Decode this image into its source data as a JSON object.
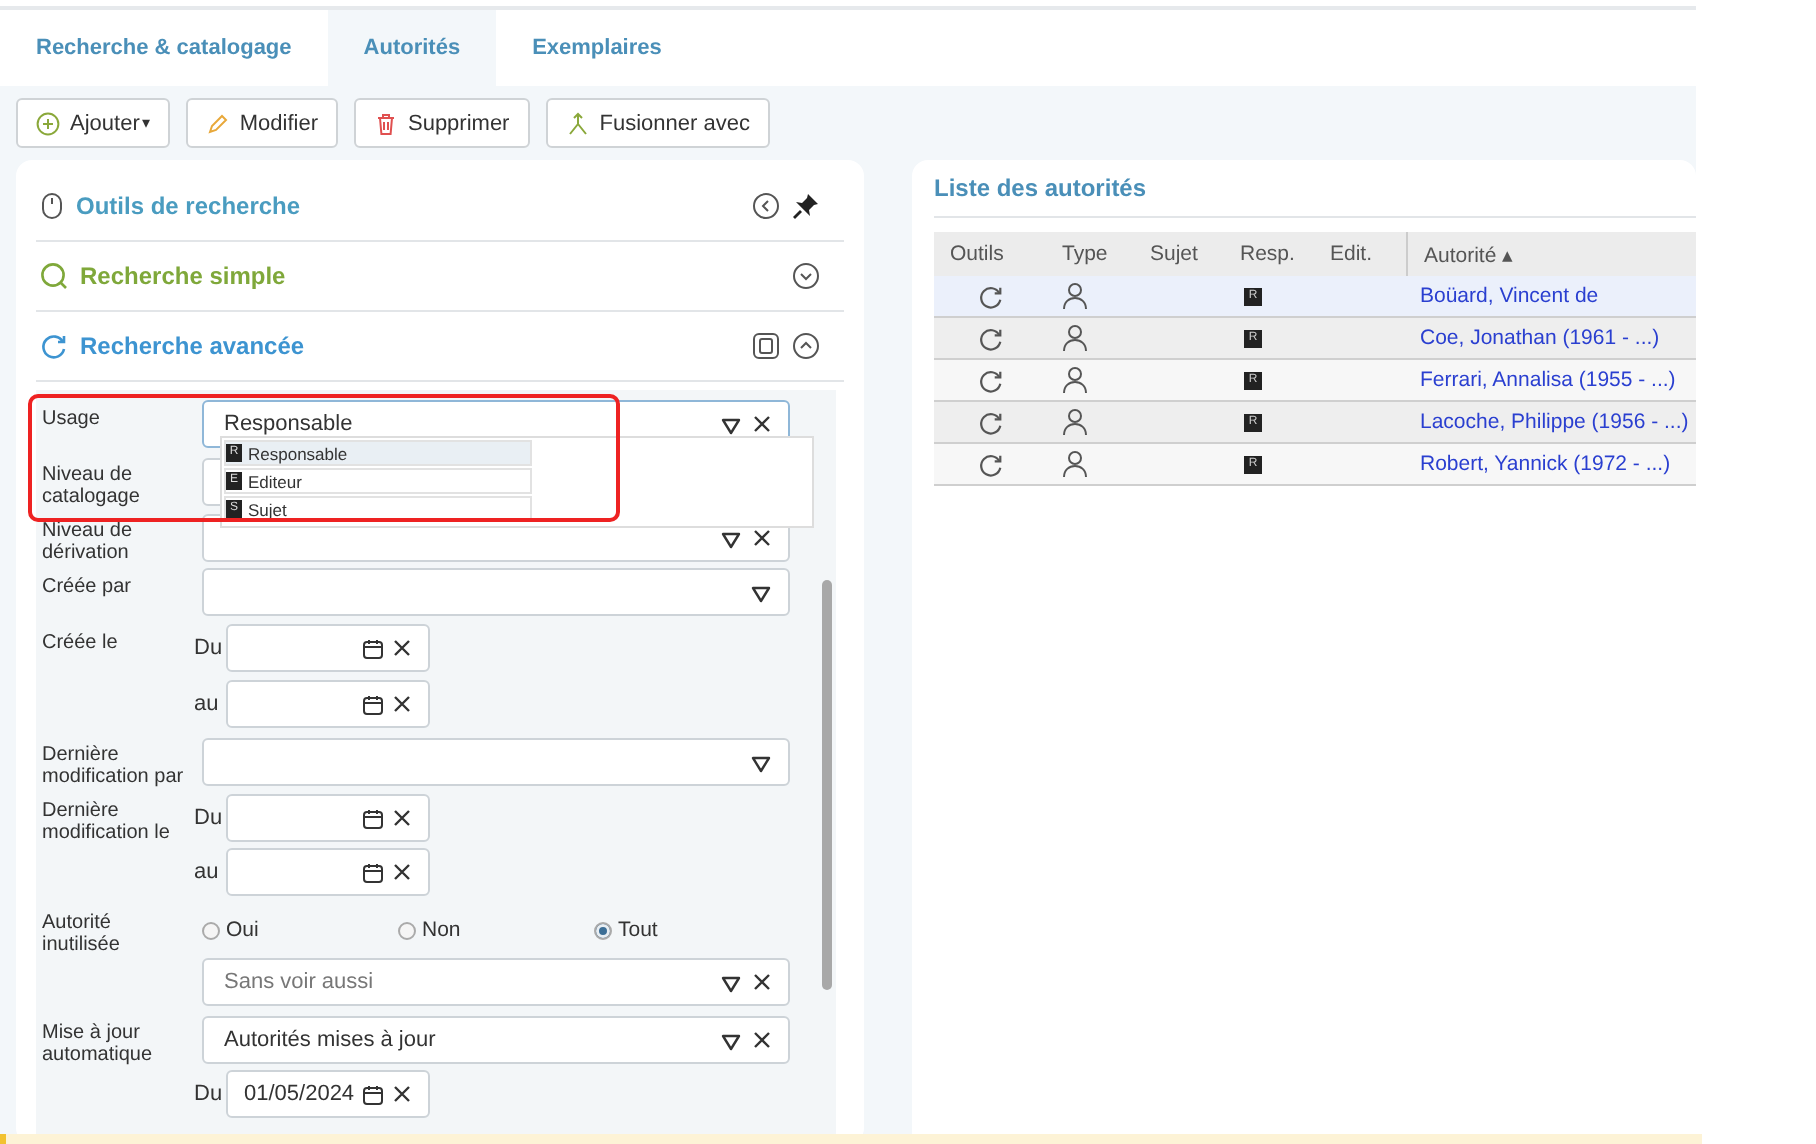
{
  "tabs": [
    {
      "label": "Recherche & catalogage",
      "selected": false
    },
    {
      "label": "Autorités",
      "selected": true
    },
    {
      "label": "Exemplaires",
      "selected": false
    }
  ],
  "toolbar": [
    {
      "kind": "add",
      "label": "Ajouter",
      "caret": "▾"
    },
    {
      "kind": "edit",
      "label": "Modifier"
    },
    {
      "kind": "delete",
      "label": "Supprimer"
    },
    {
      "kind": "merge",
      "label": "Fusionner avec"
    }
  ],
  "sections": [
    {
      "kind": "tools",
      "title": "Outils de recherche",
      "color": "#4a9cc0"
    },
    {
      "kind": "simple",
      "title": "Recherche simple",
      "color": "#7fa83a"
    },
    {
      "kind": "advanced",
      "title": "Recherche avancée",
      "color": "#3d94d1"
    }
  ],
  "form": [
    {
      "kind": "select",
      "label": "Usage",
      "value": "Responsable",
      "clearable": true,
      "focused": true,
      "dropdown": [
        {
          "badge": "R",
          "label": "Responsable",
          "selected": true
        },
        {
          "badge": "E",
          "label": "Editeur",
          "selected": false
        },
        {
          "badge": "S",
          "label": "Sujet",
          "selected": false
        }
      ]
    },
    {
      "kind": "input",
      "label": "Niveau de catalogage"
    },
    {
      "kind": "select",
      "label": "Niveau de dérivation",
      "clearable": true,
      "focused": false
    },
    {
      "kind": "select",
      "label": "Créée par",
      "clearable": false,
      "focused": false
    },
    {
      "kind": "date",
      "label": "Créée le",
      "prefix": "Du"
    },
    {
      "kind": "date",
      "prefix": "au"
    },
    {
      "kind": "select",
      "label": "Dernière modification par",
      "clearable": false,
      "focused": false
    },
    {
      "kind": "date",
      "label": "Dernière modification le",
      "prefix": "Du"
    },
    {
      "kind": "date",
      "prefix": "au"
    },
    {
      "kind": "radio",
      "label": "Autorité inutilisée",
      "options": [
        {
          "label": "Oui",
          "selected": false
        },
        {
          "label": "Non",
          "selected": false
        },
        {
          "label": "Tout",
          "selected": true
        }
      ]
    },
    {
      "kind": "select",
      "placeholder": "Sans voir aussi",
      "clearable": true,
      "focused": false
    },
    {
      "kind": "select",
      "label": "Mise à jour automatique",
      "value": "Autorités mises à jour",
      "clearable": true,
      "focused": false
    },
    {
      "kind": "date",
      "prefix": "Du",
      "value": "01/05/2024"
    }
  ],
  "list": {
    "title": "Liste des autorités",
    "columns": [
      "Outils",
      "Type",
      "Sujet",
      "Resp.",
      "Edit.",
      "Autorité ▴"
    ],
    "rows": [
      {
        "resp": "R",
        "name": "Boüard, Vincent de",
        "selected": true
      },
      {
        "resp": "R",
        "name": "Coe, Jonathan (1961 - ...)",
        "selected": false
      },
      {
        "resp": "R",
        "name": "Ferrari, Annalisa (1955 - ...)",
        "selected": false
      },
      {
        "resp": "R",
        "name": "Lacoche, Philippe (1956 - ...)",
        "selected": false
      },
      {
        "resp": "R",
        "name": "Robert, Yannick (1972 - ...)",
        "selected": false
      }
    ]
  }
}
